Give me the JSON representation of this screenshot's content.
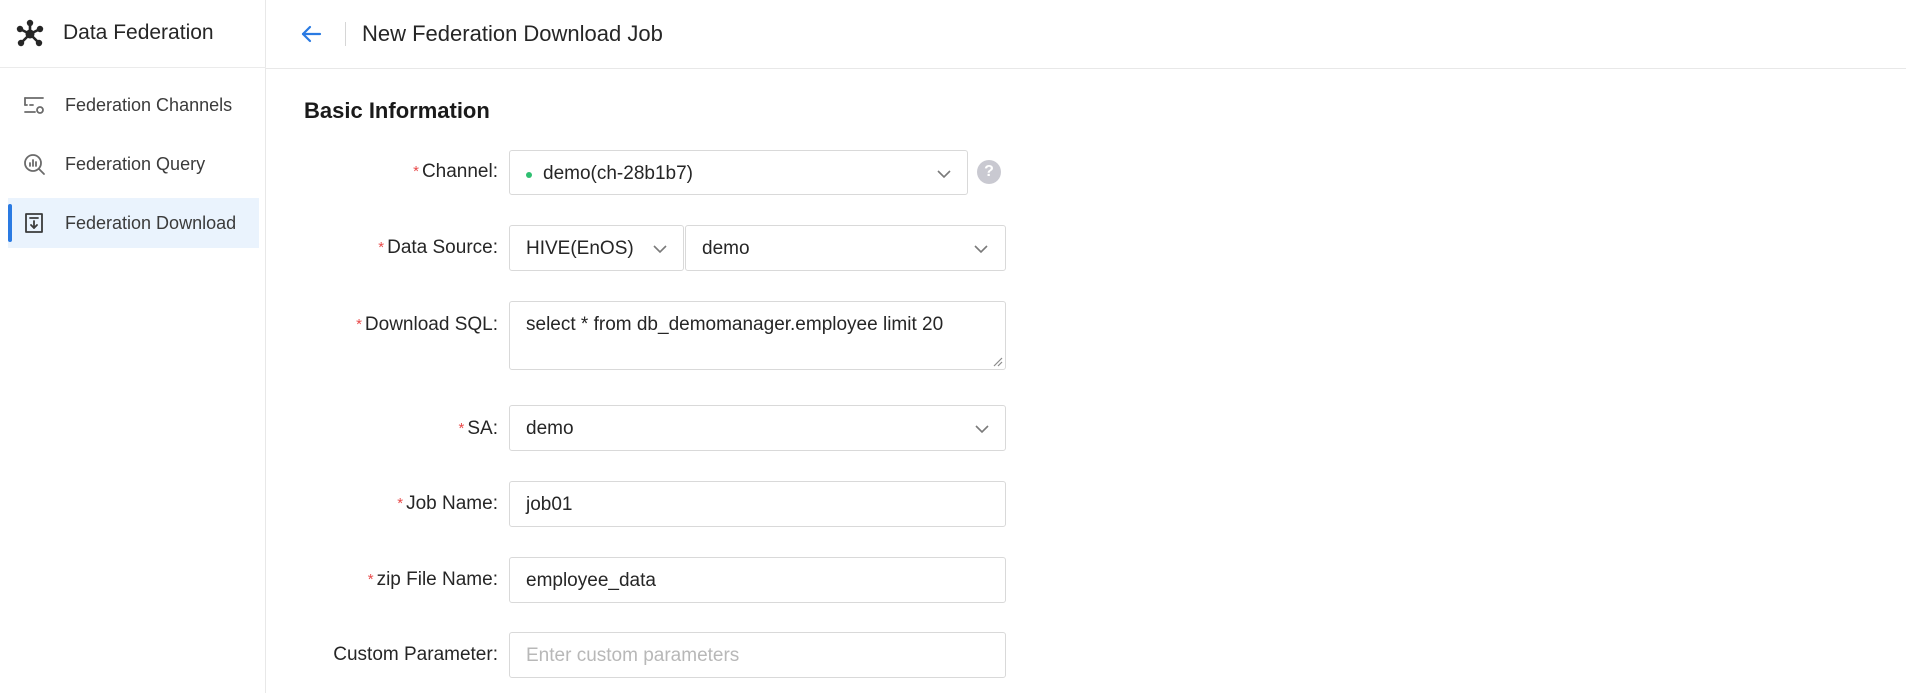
{
  "app": {
    "title": "Data Federation"
  },
  "sidebar": {
    "items": [
      {
        "label": "Federation Channels",
        "icon": "channels-icon"
      },
      {
        "label": "Federation Query",
        "icon": "query-icon"
      },
      {
        "label": "Federation Download",
        "icon": "download-icon",
        "active": true
      }
    ]
  },
  "header": {
    "title": "New Federation Download Job"
  },
  "form": {
    "section_title": "Basic Information",
    "channel": {
      "label": "Channel",
      "value": "demo(ch-28b1b7)",
      "status_color": "#2fbf71"
    },
    "data_source": {
      "label": "Data Source",
      "type_value": "HIVE(EnOS)",
      "value": "demo"
    },
    "download_sql": {
      "label": "Download SQL",
      "value": "select * from db_demomanager.employee limit 20"
    },
    "sa": {
      "label": "SA",
      "value": "demo"
    },
    "job_name": {
      "label": "Job Name",
      "value": "job01"
    },
    "zip_file_name": {
      "label": "zip File Name",
      "value": "employee_data"
    },
    "custom_parameter": {
      "label": "Custom Parameter",
      "value": "",
      "placeholder": "Enter custom parameters"
    }
  },
  "colors": {
    "accent": "#2a7ae2",
    "required": "#e84a4a",
    "active_bg": "#eaf3fd"
  }
}
